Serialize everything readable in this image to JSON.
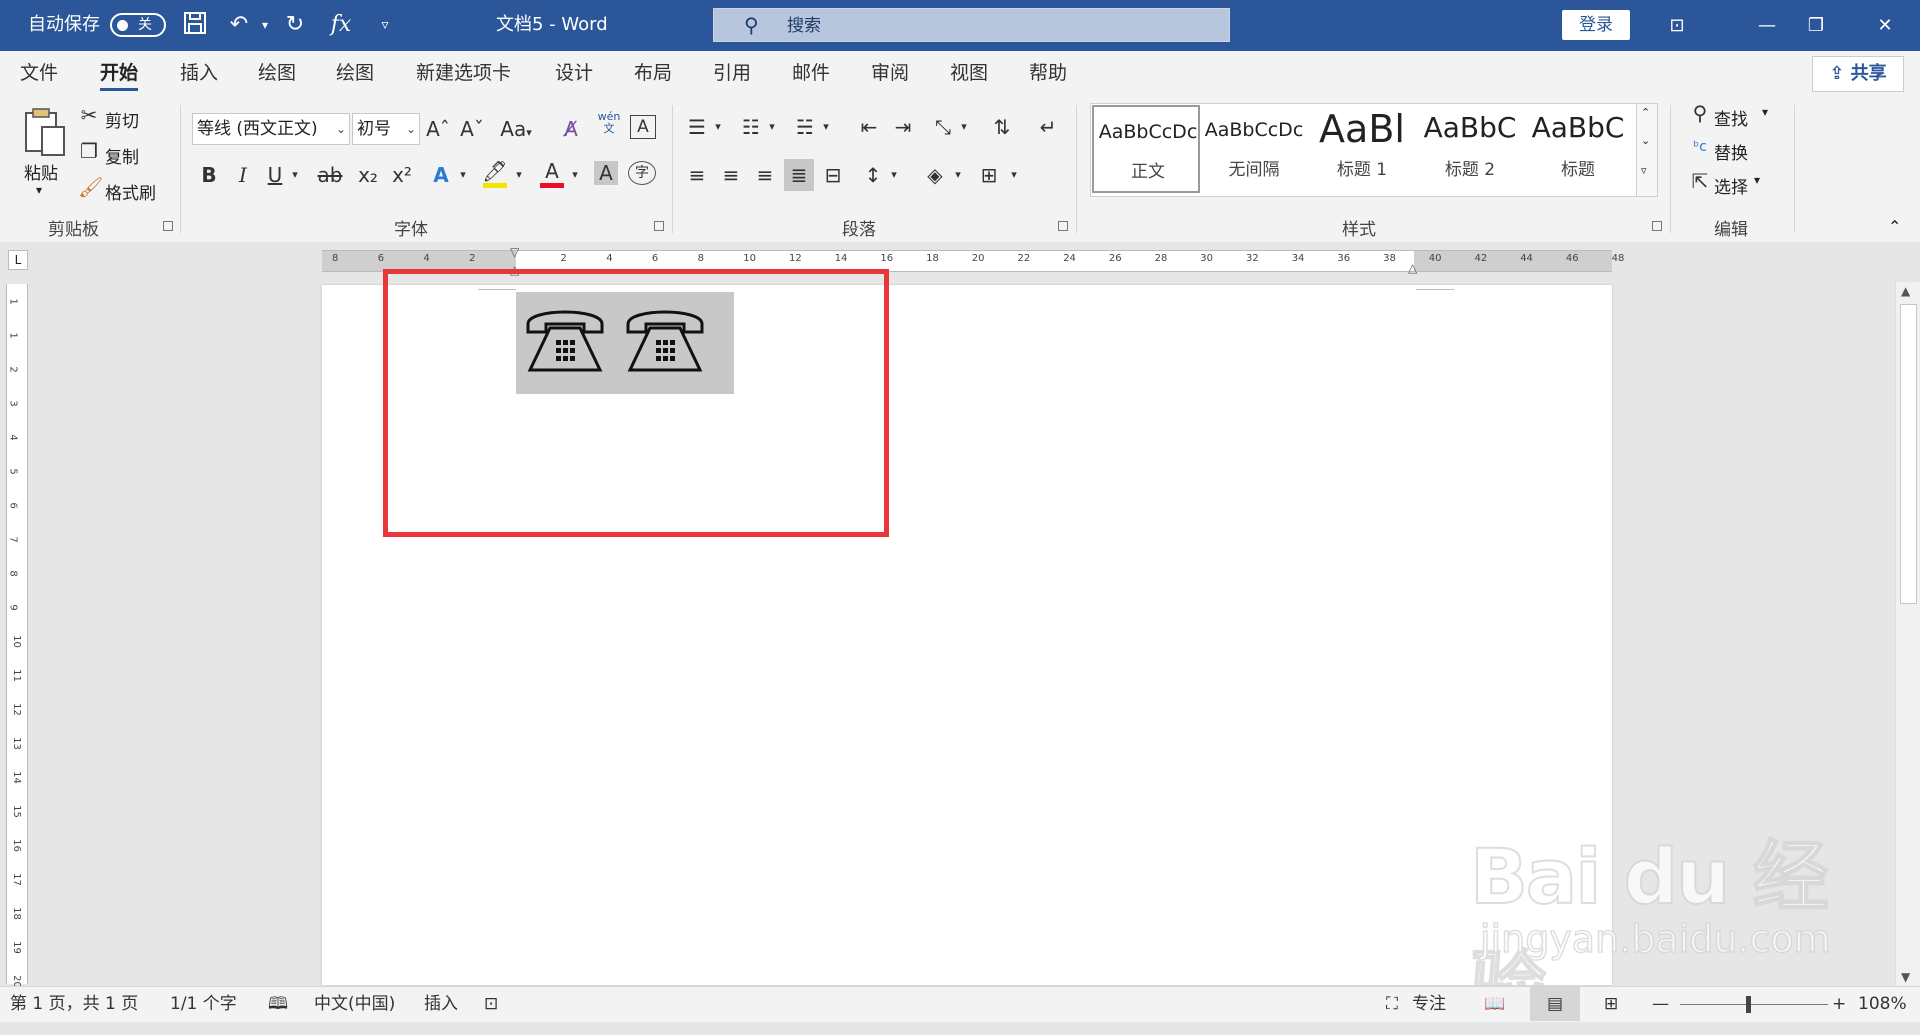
{
  "titlebar": {
    "autosave_label": "自动保存",
    "autosave_state": "关",
    "doc_title": "文档5  -  Word",
    "search_placeholder": "搜索",
    "login_label": "登录",
    "fx_label": "fx"
  },
  "tabs": [
    "文件",
    "开始",
    "插入",
    "绘图",
    "绘图",
    "新建选项卡",
    "设计",
    "布局",
    "引用",
    "邮件",
    "审阅",
    "视图",
    "帮助"
  ],
  "active_tab": "开始",
  "share_label": "共享",
  "clipboard": {
    "paste": "粘贴",
    "cut": "剪切",
    "copy": "复制",
    "format_painter": "格式刷",
    "group_label": "剪贴板"
  },
  "font": {
    "font_name": "等线 (西文正文)",
    "font_size": "初号",
    "group_label": "字体",
    "wen_label": "wén",
    "wen_char": "文",
    "change_case": "Aa",
    "bold": "B",
    "italic": "I",
    "underline": "U",
    "strike": "ab",
    "subscript": "x₂",
    "superscript": "x²",
    "text_effect": "A",
    "font_color": "A",
    "char_shading": "A",
    "enclosed_char": "字",
    "border_char": "A",
    "colors": {
      "highlight": "#f5e400",
      "font_color": "#e81123",
      "accent": "#2b579a"
    }
  },
  "paragraph": {
    "group_label": "段落"
  },
  "styles": {
    "group_label": "样式",
    "items": [
      {
        "sample": "AaBbCcDc",
        "name": "正文"
      },
      {
        "sample": "AaBbCcDc",
        "name": "无间隔"
      },
      {
        "sample": "AaBl",
        "name": "标题 1"
      },
      {
        "sample": "AaBbC",
        "name": "标题 2"
      },
      {
        "sample": "AaBbC",
        "name": "标题"
      }
    ]
  },
  "editing": {
    "find": "查找",
    "replace": "替换",
    "select": "选择",
    "group_label": "编辑"
  },
  "ruler_h": [
    "8",
    "6",
    "4",
    "2",
    "",
    "2",
    "4",
    "6",
    "8",
    "10",
    "12",
    "14",
    "16",
    "18",
    "20",
    "22",
    "24",
    "26",
    "28",
    "30",
    "32",
    "34",
    "36",
    "38",
    "40",
    "42",
    "44",
    "46",
    "48"
  ],
  "ruler_v": [
    "1",
    "1",
    "2",
    "3",
    "4",
    "5",
    "6",
    "7",
    "8",
    "9",
    "10",
    "11",
    "12",
    "13",
    "14",
    "15",
    "16",
    "17",
    "18",
    "19",
    "20"
  ],
  "statusbar": {
    "page": "第 1 页，共 1 页",
    "words": "1/1 个字",
    "language": "中文(中国)",
    "mode": "插入",
    "focus": "专注",
    "zoom": "108%"
  },
  "watermark": {
    "brand": "Bai du 经验",
    "url": "jingyan.baidu.com"
  }
}
